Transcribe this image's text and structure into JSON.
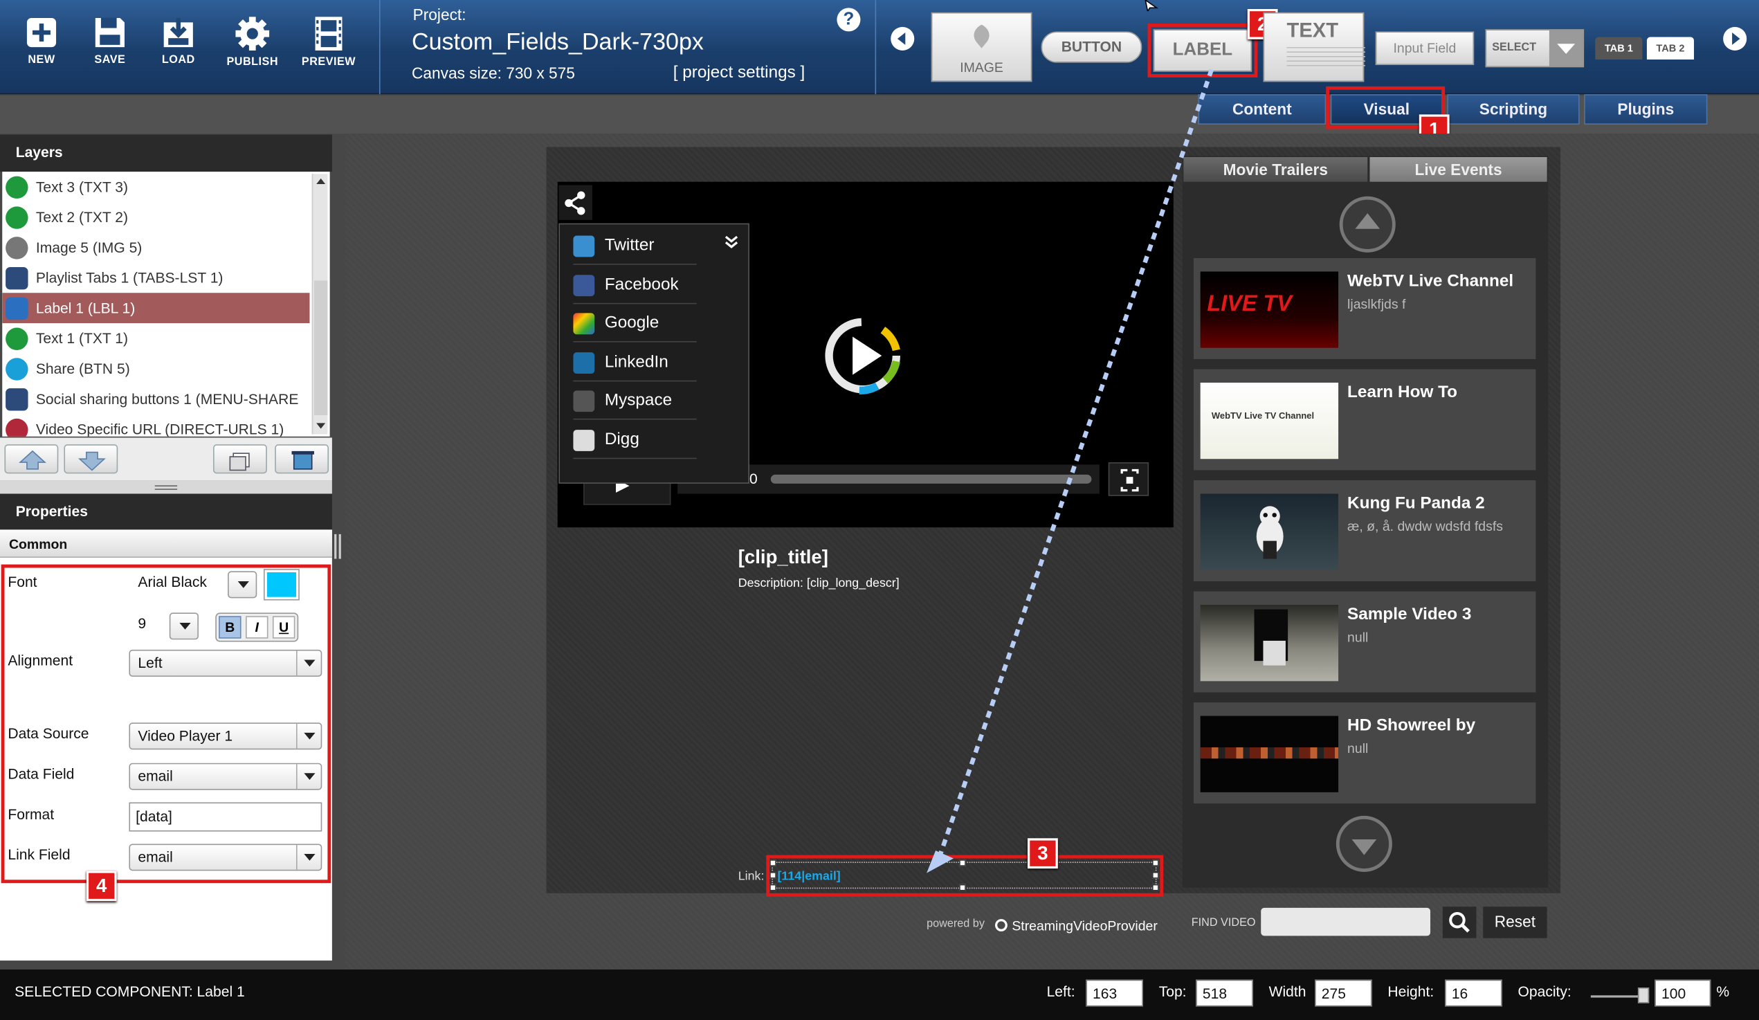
{
  "toolbar": {
    "buttons": [
      {
        "label": "NEW",
        "icon": "plus-icon"
      },
      {
        "label": "SAVE",
        "icon": "save-icon"
      },
      {
        "label": "LOAD",
        "icon": "load-icon"
      },
      {
        "label": "PUBLISH",
        "icon": "gear-icon"
      },
      {
        "label": "PREVIEW",
        "icon": "film-icon"
      }
    ],
    "project_label": "Project:",
    "project_name": "Custom_Fields_Dark-730px",
    "canvas_size": "Canvas size:  730 x 575",
    "project_settings": "[ project settings ]",
    "help": "?"
  },
  "components": {
    "image": "IMAGE",
    "button": "BUTTON",
    "label": "LABEL",
    "text": "TEXT",
    "input": "Input Field",
    "select": "SELECT",
    "tab1": "TAB 1",
    "tab2": "TAB 2"
  },
  "panel_tabs": [
    "Content",
    "Visual",
    "Scripting",
    "Plugins"
  ],
  "layers": {
    "title": "Layers",
    "items": [
      {
        "label": "Text 3 (TXT 3)",
        "icon": "text-icon",
        "color": "#1e9a3c"
      },
      {
        "label": "Text 2 (TXT 2)",
        "icon": "text-icon",
        "color": "#1e9a3c"
      },
      {
        "label": "Image 5 (IMG 5)",
        "icon": "image-icon",
        "color": "#777777"
      },
      {
        "label": "Playlist Tabs 1 (TABS-LST 1)",
        "icon": "playlist-icon",
        "color": "#2d4b7a"
      },
      {
        "label": "Label 1 (LBL 1)",
        "icon": "label-icon",
        "color": "#2a6fc0"
      },
      {
        "label": "Text 1 (TXT 1)",
        "icon": "text-icon",
        "color": "#1e9a3c"
      },
      {
        "label": "Share (BTN 5)",
        "icon": "share-icon",
        "color": "#1aa0d8"
      },
      {
        "label": "Social sharing buttons 1 (MENU-SHARE",
        "icon": "menu-icon",
        "color": "#2d4b7a"
      },
      {
        "label": "Video Specific URL (DIRECT-URLS 1)",
        "icon": "url-icon",
        "color": "#b0283a"
      }
    ]
  },
  "properties": {
    "title": "Properties",
    "section": "Common",
    "font_label": "Font",
    "font_value": "Arial Black",
    "font_color": "#00c8ff",
    "size_value": "9",
    "bold": "B",
    "italic": "I",
    "underline": "U",
    "alignment_label": "Alignment",
    "alignment_value": "Left",
    "source_label": "Data Source",
    "source_value": "Video Player 1",
    "field_label": "Data Field",
    "field_value": "email",
    "format_label": "Format",
    "format_value": "[data]",
    "link_label": "Link Field",
    "link_value": "email"
  },
  "annotations": {
    "b1": "1",
    "b2": "2",
    "b3": "3",
    "b4": "4"
  },
  "player": {
    "share_items": [
      "Twitter",
      "Facebook",
      "Google",
      "LinkedIn",
      "Myspace",
      "Digg"
    ],
    "time": "0",
    "clip_title": "[clip_title]",
    "clip_desc": "Description: [clip_long_descr]",
    "link_label": "Link:",
    "link_value": "[114|email]",
    "powered": "powered by",
    "provider": "StreamingVideoProvider",
    "find_label": "FIND VIDEO",
    "reset": "Reset"
  },
  "playlist": {
    "tabs": [
      "Movie Trailers",
      "Live Events"
    ],
    "items": [
      {
        "title": "WebTV Live Channel",
        "desc": "ljaslkfjds f"
      },
      {
        "title": "Learn How To",
        "desc": ""
      },
      {
        "title": "Kung Fu Panda 2",
        "desc": "æ, ø, å.   dwdw wdsfd  fdsfs"
      },
      {
        "title": "Sample Video 3",
        "desc": "null"
      },
      {
        "title": "HD Showreel by",
        "desc": "null"
      }
    ],
    "thumb_live": "LIVE TV",
    "thumb_learn": "WebTV Live TV Channel"
  },
  "status": {
    "selected": "SELECTED COMPONENT:  Label 1",
    "left_label": "Left:",
    "left_value": "163",
    "top_label": "Top:",
    "top_value": "518",
    "width_label": "Width",
    "width_value": "275",
    "height_label": "Height:",
    "height_value": "16",
    "opacity_label": "Opacity:",
    "opacity_value": "100",
    "percent": "%"
  }
}
